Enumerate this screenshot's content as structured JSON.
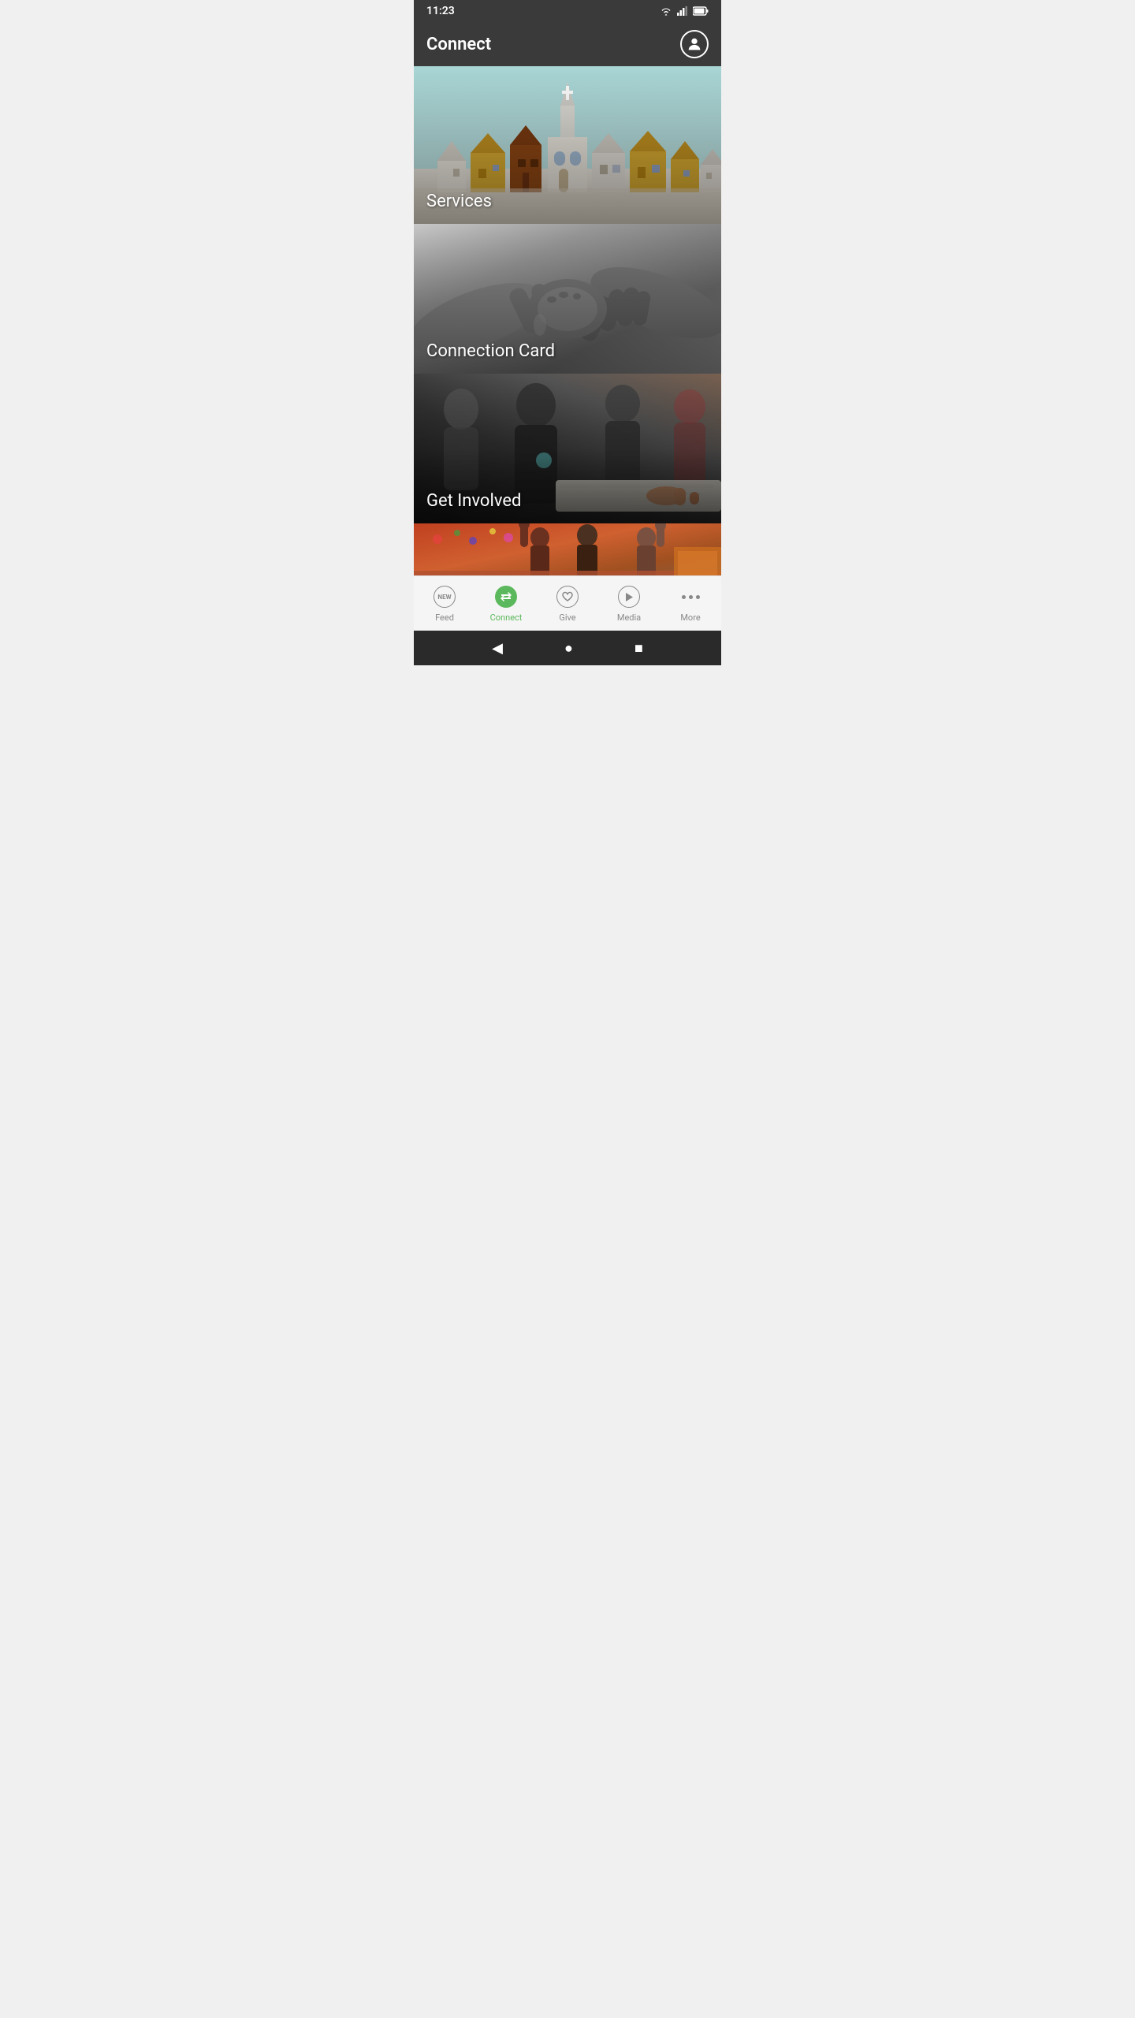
{
  "statusBar": {
    "time": "11:23",
    "wifiIcon": "wifi",
    "signalIcon": "signal",
    "batteryIcon": "battery"
  },
  "appBar": {
    "title": "Connect",
    "profileIcon": "person-circle"
  },
  "cards": [
    {
      "id": "services",
      "label": "Services",
      "bgType": "services"
    },
    {
      "id": "connection-card",
      "label": "Connection Card",
      "bgType": "handshake"
    },
    {
      "id": "get-involved",
      "label": "Get Involved",
      "bgType": "involved"
    },
    {
      "id": "kids",
      "label": "",
      "bgType": "kids"
    }
  ],
  "bottomNav": {
    "items": [
      {
        "id": "feed",
        "label": "Feed",
        "icon": "new-badge",
        "active": false
      },
      {
        "id": "connect",
        "label": "Connect",
        "icon": "arrows-swap",
        "active": true
      },
      {
        "id": "give",
        "label": "Give",
        "icon": "heart",
        "active": false
      },
      {
        "id": "media",
        "label": "Media",
        "icon": "play",
        "active": false
      },
      {
        "id": "more",
        "label": "More",
        "icon": "dots",
        "active": false
      }
    ]
  },
  "sysNav": {
    "backLabel": "◀",
    "homeLabel": "●",
    "recentLabel": "■"
  }
}
